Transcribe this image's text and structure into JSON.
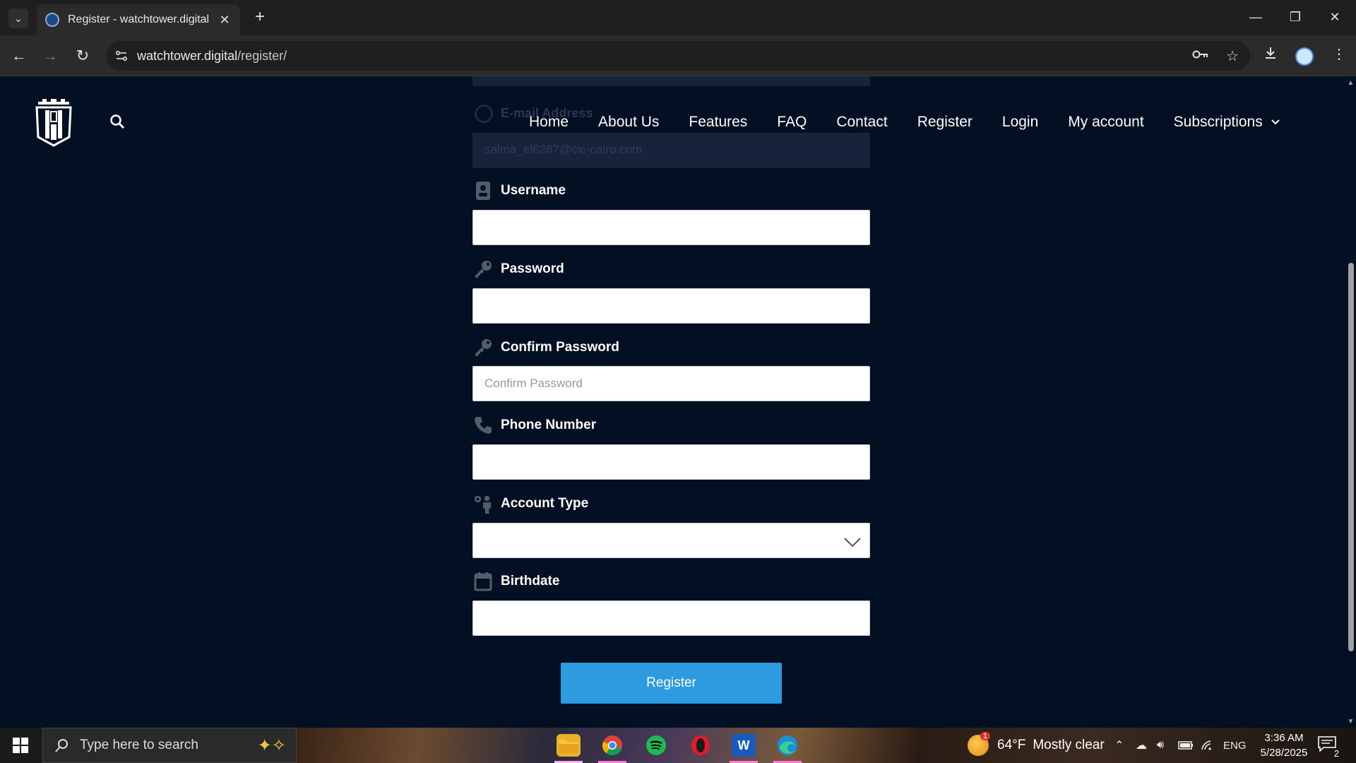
{
  "browser": {
    "tab_title": "Register - watchtower.digital",
    "url_host": "watchtower.digital",
    "url_path": "/register/"
  },
  "nav": {
    "items": [
      "Home",
      "About Us",
      "Features",
      "FAQ",
      "Contact",
      "Register",
      "Login",
      "My account",
      "Subscriptions"
    ]
  },
  "form": {
    "email_label": "E-mail Address",
    "email_value": "salma_el6287@cic-cairo.com",
    "username_label": "Username",
    "username_value": "",
    "password_label": "Password",
    "password_value": "",
    "confirm_label": "Confirm Password",
    "confirm_placeholder": "Confirm Password",
    "phone_label": "Phone Number",
    "phone_value": "",
    "account_type_label": "Account Type",
    "account_type_value": "",
    "birthdate_label": "Birthdate",
    "birthdate_value": "",
    "submit_label": "Register"
  },
  "taskbar": {
    "search_placeholder": "Type here to search",
    "weather_temp": "64°F",
    "weather_desc": "Mostly clear",
    "lang": "ENG",
    "time": "3:36 AM",
    "date": "5/28/2025",
    "notif_count": "2",
    "weather_badge": "1"
  },
  "colors": {
    "page_bg": "#030f23",
    "button": "#2e9be0"
  }
}
